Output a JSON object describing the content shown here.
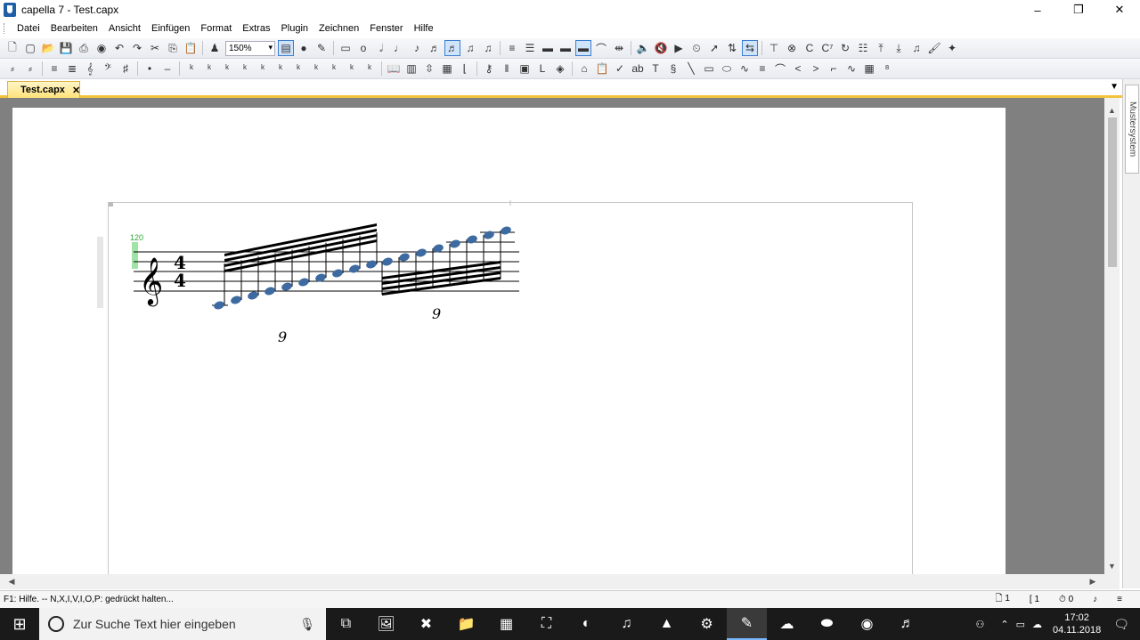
{
  "window": {
    "title": "capella 7 - Test.capx",
    "minimize": "–",
    "restore": "❐",
    "close": "✕"
  },
  "menu": [
    "Datei",
    "Bearbeiten",
    "Ansicht",
    "Einfügen",
    "Format",
    "Extras",
    "Plugin",
    "Zeichnen",
    "Fenster",
    "Hilfe"
  ],
  "toolbar": {
    "zoom": "150%"
  },
  "tabs": [
    {
      "label": "Test.capx",
      "close": "✕"
    }
  ],
  "side_panel": {
    "label": "Mustersystem"
  },
  "score": {
    "tempo_marking": "120",
    "time_signature": {
      "top": "4",
      "bottom": "4"
    },
    "tuplet_labels": [
      "9",
      "9"
    ]
  },
  "status": {
    "help": "F1: Hilfe. -- N,X,I,V,I,O,P: gedrückt halten...",
    "page": "1",
    "system": "1",
    "time": "0"
  },
  "taskbar": {
    "search_placeholder": "Zur Suche Text hier eingeben",
    "clock_time": "17:02",
    "clock_date": "04.11.2018"
  }
}
